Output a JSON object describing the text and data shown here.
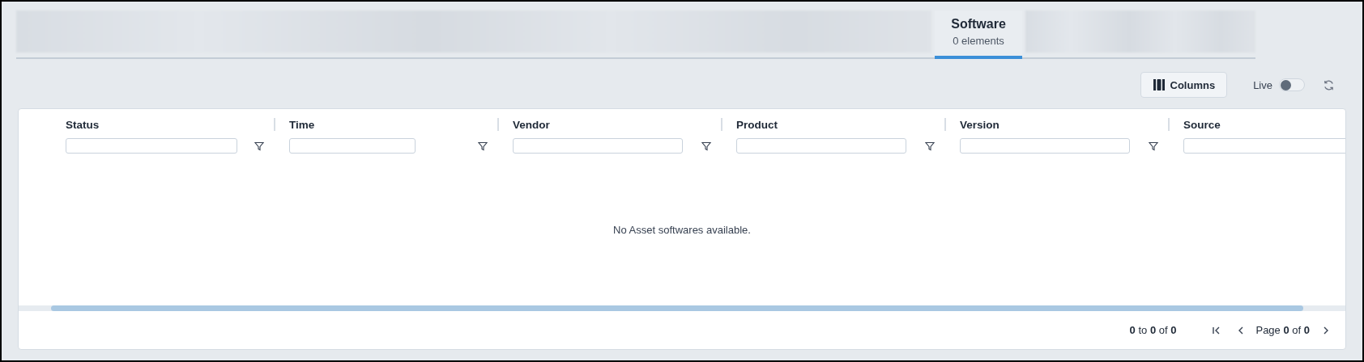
{
  "tabs": [
    {
      "kind": "blurred"
    },
    {
      "kind": "tab",
      "label": "Software",
      "count": "0 elements",
      "selected": true
    },
    {
      "kind": "blurred"
    }
  ],
  "toolbar": {
    "columns_button": "Columns",
    "live": {
      "label": "Live",
      "on": false
    }
  },
  "table": {
    "columns": [
      {
        "label": "Status"
      },
      {
        "label": "Time"
      },
      {
        "label": "Vendor"
      },
      {
        "label": "Product"
      },
      {
        "label": "Version"
      },
      {
        "label": "Source"
      }
    ],
    "empty_message": "No Asset softwares available.",
    "pagination": {
      "range": "**0** to **0** of **0**",
      "page": "Page **0** of **0**"
    }
  }
}
